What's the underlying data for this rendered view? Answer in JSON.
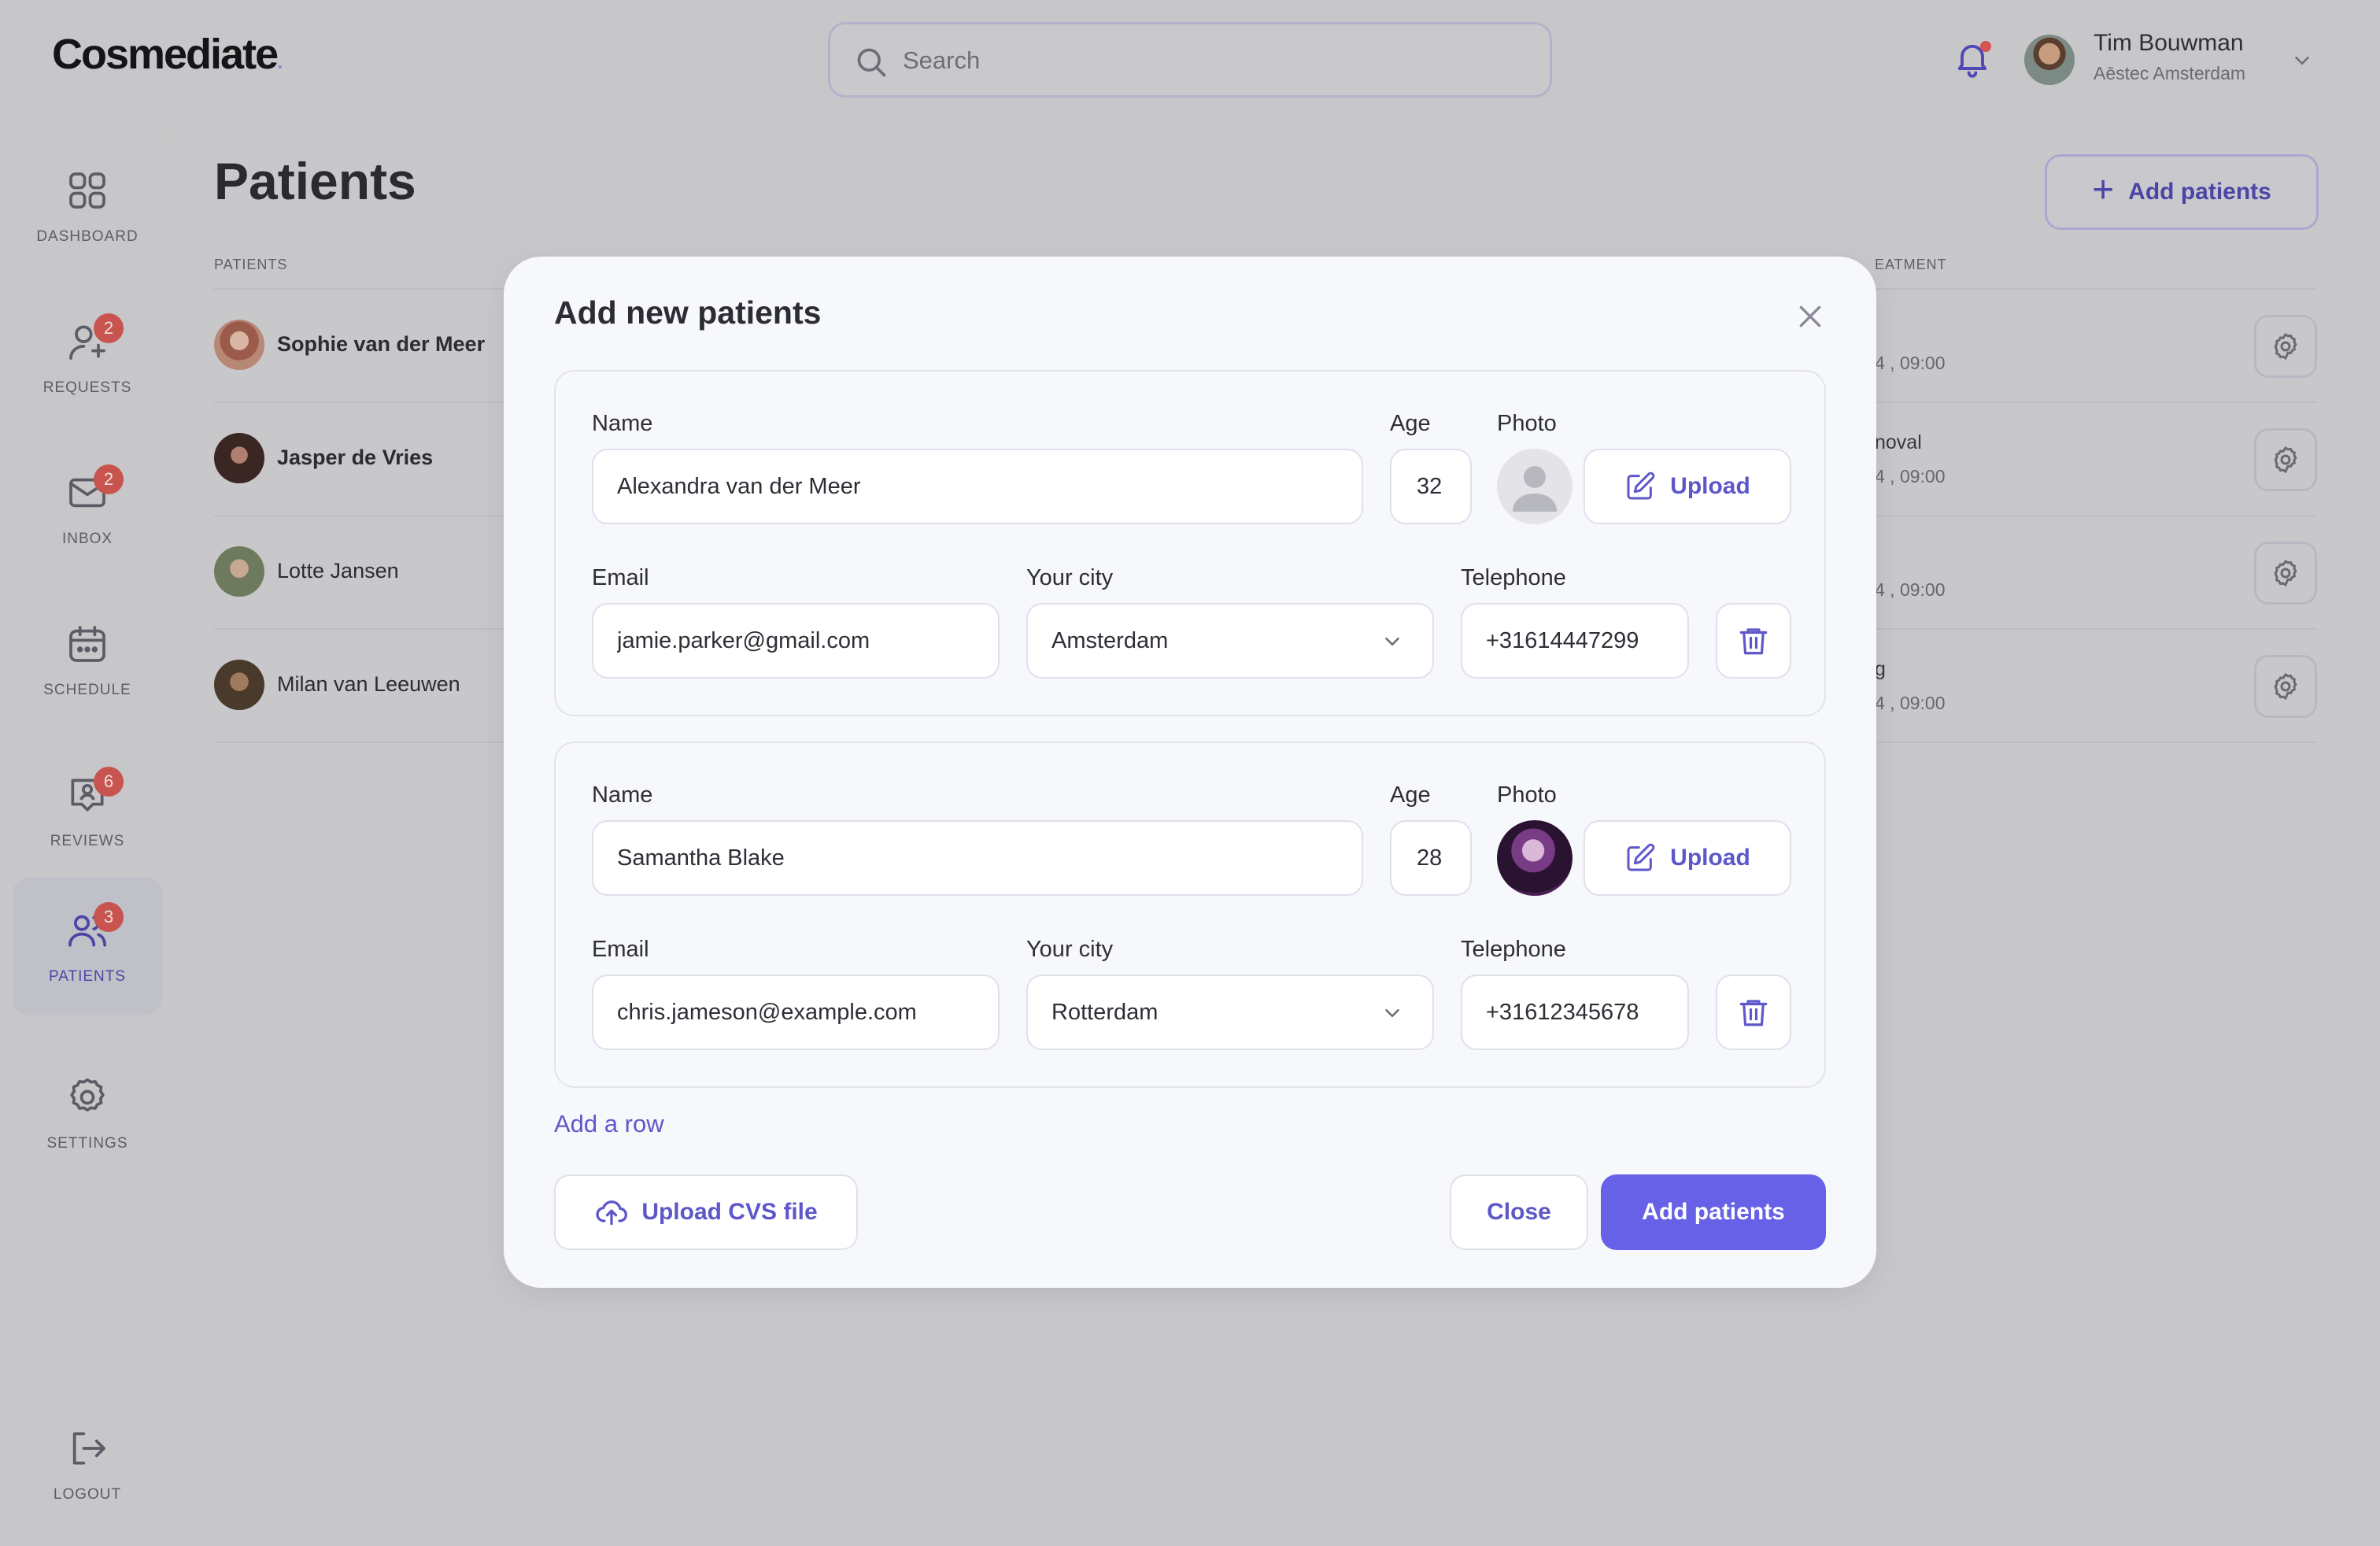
{
  "app": {
    "logo": "Cosmediate",
    "logo_dot": "."
  },
  "search": {
    "placeholder": "Search"
  },
  "user": {
    "name": "Tim Bouwman",
    "org": "Aēstec Amsterdam"
  },
  "sidebar": {
    "items": [
      {
        "label": "DASHBOARD",
        "icon": "grid-icon",
        "badge": ""
      },
      {
        "label": "REQUESTS",
        "icon": "user-plus-icon",
        "badge": "2"
      },
      {
        "label": "INBOX",
        "icon": "mail-icon",
        "badge": "2"
      },
      {
        "label": "SCHEDULE",
        "icon": "calendar-icon",
        "badge": ""
      },
      {
        "label": "REVIEWS",
        "icon": "review-icon",
        "badge": "6"
      },
      {
        "label": "PATIENTS",
        "icon": "users-icon",
        "badge": "3",
        "active": true
      },
      {
        "label": "SETTINGS",
        "icon": "gear-icon",
        "badge": ""
      }
    ],
    "logout": "LOGOUT"
  },
  "page": {
    "title": "Patients",
    "add_button": "Add patients",
    "col_patients": "PATIENTS",
    "col_treatment_partial": "EATMENT",
    "rows": [
      {
        "name": "Sophie van der Meer",
        "bold": true,
        "treatment": "",
        "date": "4 , 09:00"
      },
      {
        "name": "Jasper de Vries",
        "bold": true,
        "treatment": "noval",
        "date": "4 , 09:00"
      },
      {
        "name": "Lotte Jansen",
        "bold": false,
        "treatment": "",
        "date": "4 , 09:00"
      },
      {
        "name": "Milan van Leeuwen",
        "bold": false,
        "treatment": "g",
        "date": "4 , 09:00"
      }
    ]
  },
  "modal": {
    "title": "Add new patients",
    "labels": {
      "name": "Name",
      "age": "Age",
      "photo": "Photo",
      "email": "Email",
      "city": "Your city",
      "telephone": "Telephone"
    },
    "upload_label": "Upload",
    "entries": [
      {
        "name": "Alexandra van der Meer",
        "age": "32",
        "email": "jamie.parker@gmail.com",
        "city": "Amsterdam",
        "telephone": "+31614447299",
        "photo": "placeholder"
      },
      {
        "name": "Samantha Blake",
        "age": "28",
        "email": "chris.jameson@example.com",
        "city": "Rotterdam",
        "telephone": "+31612345678",
        "photo": "image"
      }
    ],
    "add_row": "Add a row",
    "upload_csv": "Upload CVS file",
    "close": "Close",
    "submit": "Add patients"
  },
  "colors": {
    "accent": "#6661e6",
    "badge": "#c8544f",
    "text": "#2e2e36"
  }
}
